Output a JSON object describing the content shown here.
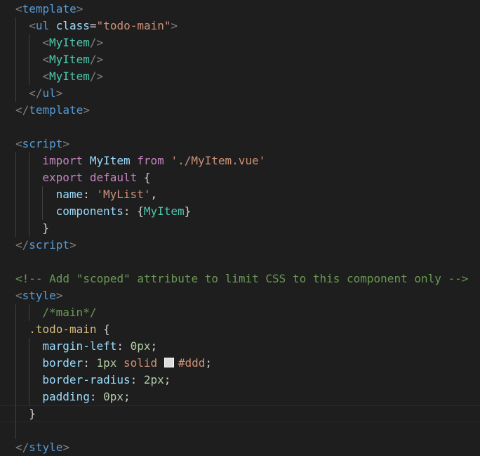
{
  "editor": {
    "language": "vue",
    "swatch_color": "#dddddd",
    "lines": [
      {
        "indent": "",
        "tokens": [
          [
            "t",
            "<"
          ],
          [
            "tg",
            "template"
          ],
          [
            "t",
            ">"
          ]
        ]
      },
      {
        "indent": "  ",
        "tokens": [
          [
            "t",
            "<"
          ],
          [
            "tg",
            "ul"
          ],
          [
            "pn",
            " "
          ],
          [
            "at",
            "class"
          ],
          [
            "pn",
            "="
          ],
          [
            "st",
            "\"todo-main\""
          ],
          [
            "t",
            ">"
          ]
        ]
      },
      {
        "indent": "    ",
        "tokens": [
          [
            "t",
            "<"
          ],
          [
            "cp",
            "MyItem"
          ],
          [
            "t",
            "/>"
          ]
        ]
      },
      {
        "indent": "    ",
        "tokens": [
          [
            "t",
            "<"
          ],
          [
            "cp",
            "MyItem"
          ],
          [
            "t",
            "/>"
          ]
        ]
      },
      {
        "indent": "    ",
        "tokens": [
          [
            "t",
            "<"
          ],
          [
            "cp",
            "MyItem"
          ],
          [
            "t",
            "/>"
          ]
        ]
      },
      {
        "indent": "  ",
        "tokens": [
          [
            "t",
            "</"
          ],
          [
            "tg",
            "ul"
          ],
          [
            "t",
            ">"
          ]
        ]
      },
      {
        "indent": "",
        "tokens": [
          [
            "t",
            "</"
          ],
          [
            "tg",
            "template"
          ],
          [
            "t",
            ">"
          ]
        ]
      },
      {
        "indent": "",
        "tokens": []
      },
      {
        "indent": "",
        "tokens": [
          [
            "t",
            "<"
          ],
          [
            "tg",
            "script"
          ],
          [
            "t",
            ">"
          ]
        ]
      },
      {
        "indent": "    ",
        "tokens": [
          [
            "kw",
            "import"
          ],
          [
            "pn",
            " "
          ],
          [
            "vr",
            "MyItem"
          ],
          [
            "pn",
            " "
          ],
          [
            "kw",
            "from"
          ],
          [
            "pn",
            " "
          ],
          [
            "st",
            "'./MyItem.vue'"
          ]
        ]
      },
      {
        "indent": "    ",
        "tokens": [
          [
            "kw",
            "export"
          ],
          [
            "pn",
            " "
          ],
          [
            "kw",
            "default"
          ],
          [
            "pn",
            " {"
          ]
        ]
      },
      {
        "indent": "      ",
        "tokens": [
          [
            "vr",
            "name"
          ],
          [
            "pn",
            ": "
          ],
          [
            "st",
            "'MyList'"
          ],
          [
            "pn",
            ","
          ]
        ]
      },
      {
        "indent": "      ",
        "tokens": [
          [
            "vr",
            "components"
          ],
          [
            "pn",
            ": {"
          ],
          [
            "cp",
            "MyItem"
          ],
          [
            "pn",
            "}"
          ]
        ]
      },
      {
        "indent": "    ",
        "tokens": [
          [
            "pn",
            "}"
          ]
        ]
      },
      {
        "indent": "",
        "tokens": [
          [
            "t",
            "</"
          ],
          [
            "tg",
            "script"
          ],
          [
            "t",
            ">"
          ]
        ]
      },
      {
        "indent": "",
        "tokens": []
      },
      {
        "indent": "",
        "tokens": [
          [
            "cm",
            "<!-- Add \"scoped\" attribute to limit CSS to this component only -->"
          ]
        ]
      },
      {
        "indent": "",
        "tokens": [
          [
            "t",
            "<"
          ],
          [
            "tg",
            "style"
          ],
          [
            "t",
            ">"
          ]
        ]
      },
      {
        "indent": "    ",
        "tokens": [
          [
            "cm",
            "/*main*/"
          ]
        ]
      },
      {
        "indent": "  ",
        "tokens": [
          [
            "sel",
            ".todo-main"
          ],
          [
            "pn",
            " {"
          ]
        ]
      },
      {
        "indent": "    ",
        "tokens": [
          [
            "pr",
            "margin-left"
          ],
          [
            "pn",
            ": "
          ],
          [
            "nu",
            "0px"
          ],
          [
            "pn",
            ";"
          ]
        ]
      },
      {
        "indent": "    ",
        "tokens": [
          [
            "pr",
            "border"
          ],
          [
            "pn",
            ": "
          ],
          [
            "nu",
            "1px"
          ],
          [
            "pn",
            " "
          ],
          [
            "cv",
            "solid"
          ],
          [
            "pn",
            " "
          ],
          [
            "swatch",
            ""
          ],
          [
            "cv",
            "#ddd"
          ],
          [
            "pn",
            ";"
          ]
        ]
      },
      {
        "indent": "    ",
        "tokens": [
          [
            "pr",
            "border-radius"
          ],
          [
            "pn",
            ": "
          ],
          [
            "nu",
            "2px"
          ],
          [
            "pn",
            ";"
          ]
        ]
      },
      {
        "indent": "    ",
        "tokens": [
          [
            "pr",
            "padding"
          ],
          [
            "pn",
            ": "
          ],
          [
            "nu",
            "0px"
          ],
          [
            "pn",
            ";"
          ]
        ]
      },
      {
        "indent": "  ",
        "tokens": [
          [
            "pn",
            "}"
          ]
        ],
        "current": true
      },
      {
        "indent": "",
        "tokens": []
      },
      {
        "indent": "",
        "tokens": [
          [
            "t",
            "</"
          ],
          [
            "tg",
            "style"
          ],
          [
            "t",
            ">"
          ]
        ]
      }
    ]
  }
}
